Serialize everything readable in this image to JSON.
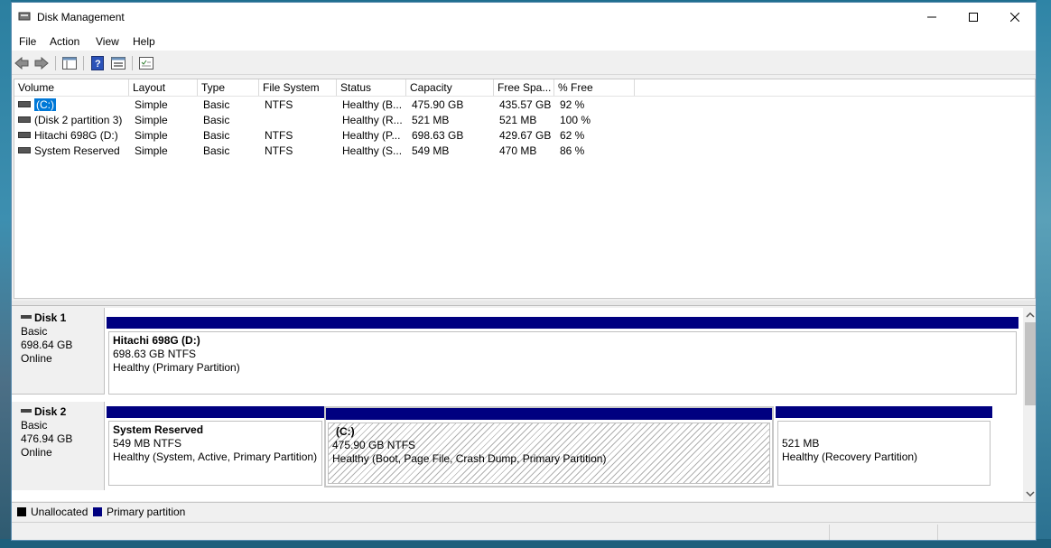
{
  "window": {
    "title": "Disk Management"
  },
  "menu": [
    "File",
    "Action",
    "View",
    "Help"
  ],
  "volumes": {
    "columns": [
      "Volume",
      "Layout",
      "Type",
      "File System",
      "Status",
      "Capacity",
      "Free Spa...",
      "% Free"
    ],
    "rows": [
      [
        "(C:)",
        "Simple",
        "Basic",
        "NTFS",
        "Healthy (B...",
        "475.90 GB",
        "435.57 GB",
        "92 %"
      ],
      [
        "(Disk 2 partition 3)",
        "Simple",
        "Basic",
        "",
        "Healthy (R...",
        "521 MB",
        "521 MB",
        "100 %"
      ],
      [
        "Hitachi 698G (D:)",
        "Simple",
        "Basic",
        "NTFS",
        "Healthy (P...",
        "698.63 GB",
        "429.67 GB",
        "62 %"
      ],
      [
        "System Reserved",
        "Simple",
        "Basic",
        "NTFS",
        "Healthy (S...",
        "549 MB",
        "470 MB",
        "86 %"
      ]
    ]
  },
  "disks": [
    {
      "name": "Disk 1",
      "type": "Basic",
      "size": "698.64 GB",
      "state": "Online",
      "partitions": [
        {
          "name": "Hitachi 698G  (D:)",
          "size": "698.63 GB NTFS",
          "status": "Healthy (Primary Partition)"
        }
      ]
    },
    {
      "name": "Disk 2",
      "type": "Basic",
      "size": "476.94 GB",
      "state": "Online",
      "partitions": [
        {
          "name": "System Reserved",
          "size": "549 MB NTFS",
          "status": "Healthy (System, Active, Primary Partition)"
        },
        {
          "name": "(C:)",
          "size": "475.90 GB NTFS",
          "status": "Healthy (Boot, Page File, Crash Dump, Primary Partition)"
        },
        {
          "name": "",
          "size": "521 MB",
          "status": "Healthy (Recovery Partition)"
        }
      ]
    }
  ],
  "legend": [
    {
      "label": "Unallocated",
      "color": "#000000"
    },
    {
      "label": "Primary partition",
      "color": "#000080"
    }
  ]
}
